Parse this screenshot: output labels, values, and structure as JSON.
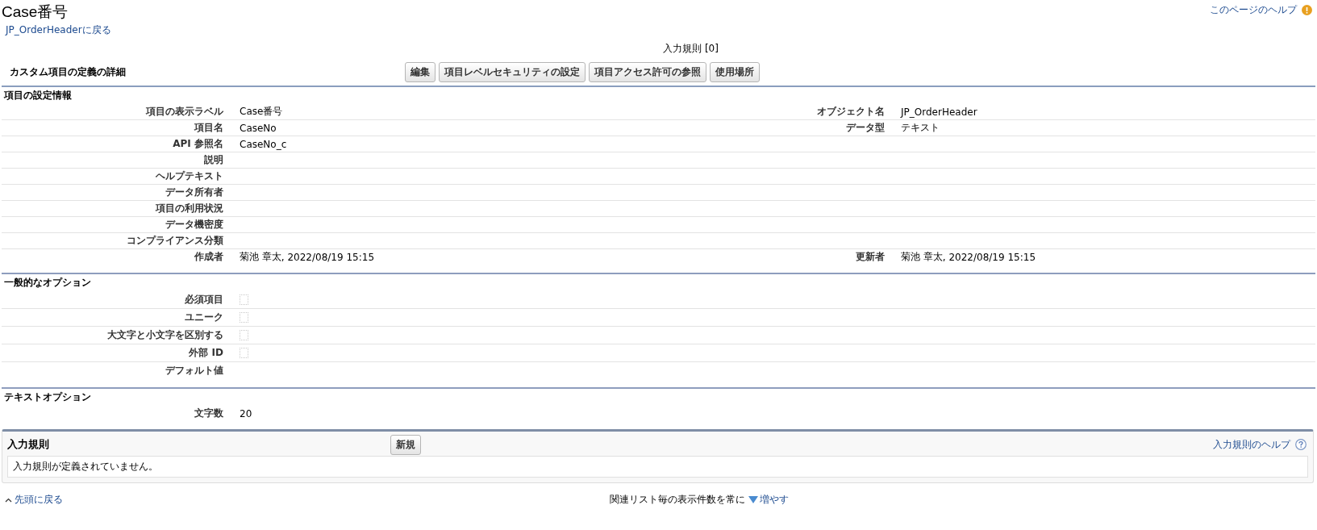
{
  "header": {
    "title": "Case番号",
    "back_link": "JP_OrderHeaderに戻る",
    "help_link": "このページのヘルプ"
  },
  "related_links": [
    {
      "label": "入力規則",
      "count": "[0]"
    }
  ],
  "detail": {
    "title": "カスタム項目の定義の詳細",
    "buttons": [
      "編集",
      "項目レベルセキュリティの設定",
      "項目アクセス許可の参照",
      "使用場所"
    ]
  },
  "sections": [
    {
      "title": "項目の設定情報",
      "rows": [
        {
          "left": {
            "label": "項目の表示ラベル",
            "kind": "text",
            "value": "Case番号"
          },
          "right": {
            "label": "オブジェクト名",
            "kind": "link",
            "value": "JP_OrderHeader"
          }
        },
        {
          "left": {
            "label": "項目名",
            "kind": "text",
            "value": "CaseNo"
          },
          "right": {
            "label": "データ型",
            "kind": "text",
            "value": "テキスト"
          }
        },
        {
          "left": {
            "label": "API 参照名",
            "kind": "text",
            "value": "CaseNo_c"
          }
        },
        {
          "left": {
            "label": "説明"
          }
        },
        {
          "left": {
            "label": "ヘルプテキスト"
          }
        },
        {
          "left": {
            "label": "データ所有者"
          }
        },
        {
          "left": {
            "label": "項目の利用状況"
          }
        },
        {
          "left": {
            "label": "データ機密度"
          }
        },
        {
          "left": {
            "label": "コンプライアンス分類"
          }
        },
        {
          "left": {
            "label": "作成者",
            "kind": "stamp",
            "value": "菊池 章太",
            "suffix": ", 2022/08/19 15:15"
          },
          "right": {
            "label": "更新者",
            "kind": "stamp",
            "value": "菊池 章太",
            "suffix": ", 2022/08/19 15:15"
          }
        }
      ]
    },
    {
      "title": "一般的なオプション",
      "rows": [
        {
          "left": {
            "label": "必須項目",
            "kind": "checkbox",
            "checked": false
          }
        },
        {
          "left": {
            "label": "ユニーク",
            "kind": "checkbox",
            "checked": false
          }
        },
        {
          "left": {
            "label": "大文字と小文字を区別する",
            "kind": "checkbox",
            "checked": false
          }
        },
        {
          "left": {
            "label": "外部 ID",
            "kind": "checkbox",
            "checked": false
          }
        },
        {
          "left": {
            "label": "デフォルト値"
          }
        }
      ]
    },
    {
      "title": "テキストオプション",
      "rows": [
        {
          "left": {
            "label": "文字数",
            "kind": "text",
            "value": "20"
          }
        }
      ]
    }
  ],
  "related_list": {
    "title": "入力規則",
    "button": "新規",
    "help_link": "入力規則のヘルプ",
    "empty_message": "入力規則が定義されていません。"
  },
  "footer": {
    "top_link": "先頭に戻る",
    "note": "関連リスト毎の表示件数を常に",
    "more_link": "増やす"
  }
}
